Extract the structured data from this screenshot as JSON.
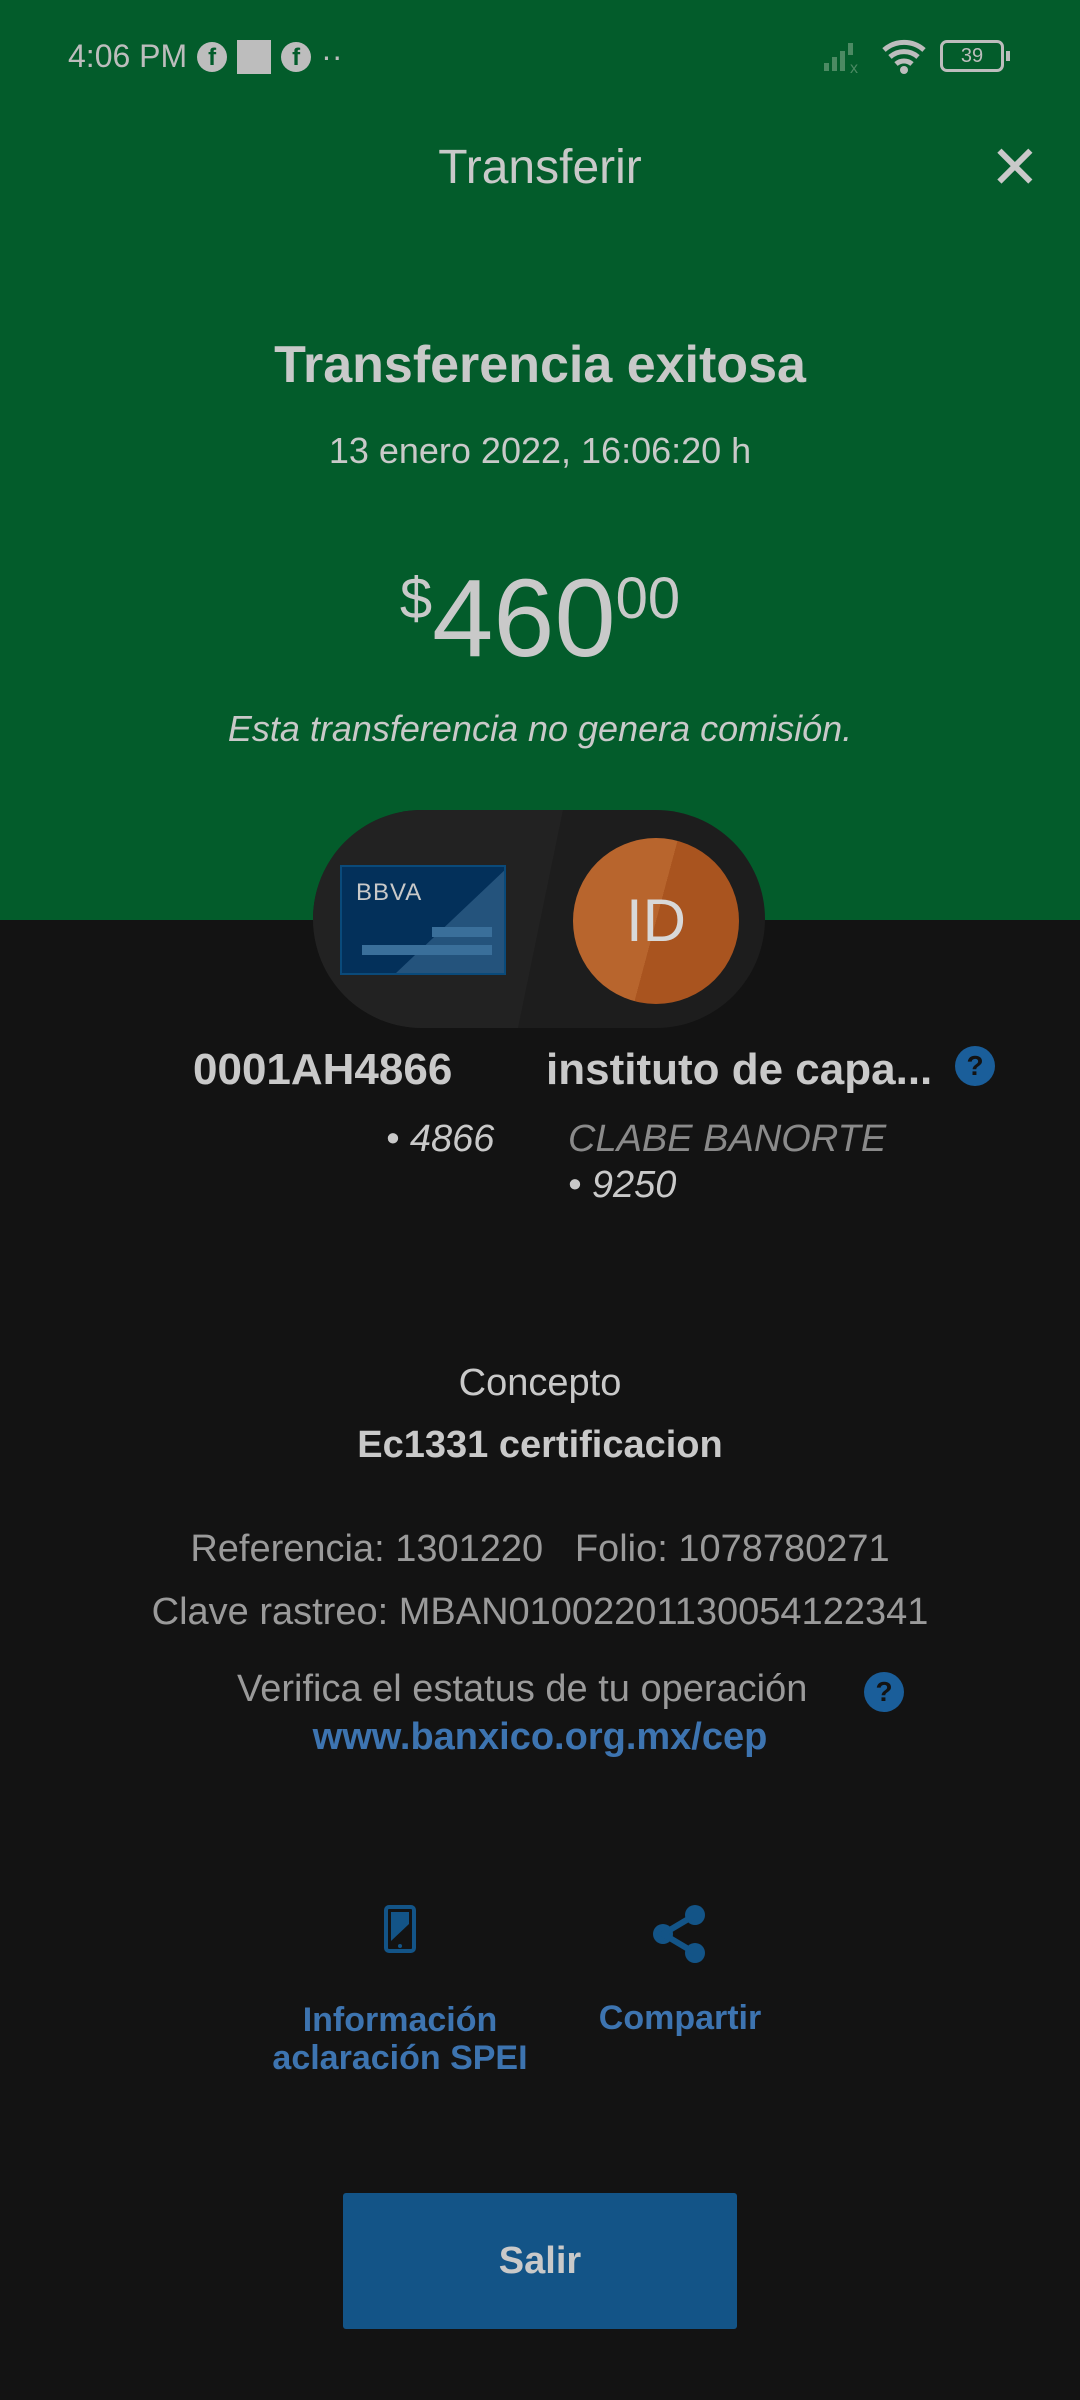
{
  "status_bar": {
    "time": "4:06 PM",
    "battery": "39",
    "icons": [
      "facebook-icon",
      "square-icon",
      "facebook-icon",
      "more-dots-icon",
      "signal-icon",
      "wifi-icon",
      "battery-icon"
    ]
  },
  "header": {
    "title": "Transferir",
    "close_icon": "close-icon"
  },
  "summary": {
    "heading": "Transferencia exitosa",
    "date": "13 enero 2022, 16:06:20 h",
    "currency": "$",
    "amount_int": "460",
    "amount_dec": "00",
    "note": "Esta transferencia no genera comisión."
  },
  "origin": {
    "bank_logo": "BBVA",
    "account": "0001AH4866",
    "last_digits": "• 4866"
  },
  "destination": {
    "initials": "ID",
    "name": "instituto de capa...",
    "bank": "CLABE BANORTE",
    "last_digits": "• 9250"
  },
  "concept": {
    "label": "Concepto",
    "value": "Ec1331 certificacion"
  },
  "details": {
    "reference": "Referencia: 1301220",
    "folio": "Folio: 1078780271",
    "tracking": "Clave rastreo: MBAN01002201130054122341"
  },
  "verify": {
    "text": "Verifica el estatus de tu operación",
    "link": "www.banxico.org.mx/cep"
  },
  "actions": [
    {
      "label1": "Información",
      "label2": "aclaración SPEI",
      "icon": "phone-icon"
    },
    {
      "label1": "Compartir",
      "icon": "share-icon"
    }
  ],
  "exit_button": "Salir",
  "colors": {
    "header_green": "#035c2b",
    "background": "#131313",
    "accent_blue": "#135487",
    "link_blue": "#3d74b0",
    "avatar_orange": "#b8652d"
  }
}
